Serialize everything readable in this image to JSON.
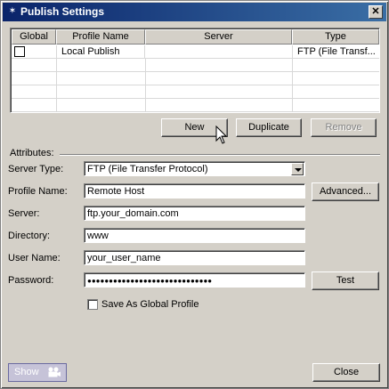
{
  "window": {
    "title": "Publish Settings"
  },
  "table": {
    "columns": [
      "Global",
      "Profile Name",
      "Server",
      "Type"
    ],
    "rows": [
      {
        "global": false,
        "profile_name": "Local Publish",
        "server": "",
        "type": "FTP (File Transf..."
      }
    ]
  },
  "buttons": {
    "new": "New",
    "duplicate": "Duplicate",
    "remove": "Remove",
    "advanced": "Advanced...",
    "test": "Test",
    "close": "Close",
    "show": "Show"
  },
  "attributes": {
    "group_label": "Attributes:",
    "server_type_label": "Server Type:",
    "server_type_value": "FTP (File Transfer Protocol)",
    "profile_name_label": "Profile Name:",
    "profile_name_value": "Remote Host",
    "server_label": "Server:",
    "server_value": "ftp.your_domain.com",
    "directory_label": "Directory:",
    "directory_value": "www",
    "user_name_label": "User Name:",
    "user_name_value": "your_user_name",
    "password_label": "Password:",
    "password_value": "●●●●●●●●●●●●●●●●●●●●●●●●●●●●●",
    "global_checkbox_label": "Save As Global Profile",
    "global_checkbox_checked": false
  }
}
